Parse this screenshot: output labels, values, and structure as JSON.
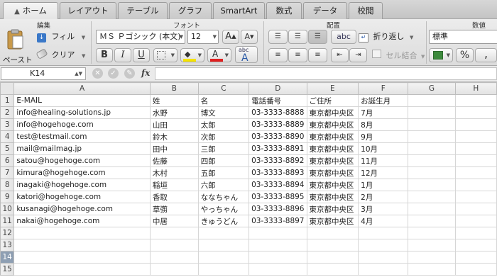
{
  "tabs": [
    {
      "label": "ホーム",
      "active": true
    },
    {
      "label": "レイアウト"
    },
    {
      "label": "テーブル"
    },
    {
      "label": "グラフ"
    },
    {
      "label": "SmartArt"
    },
    {
      "label": "数式"
    },
    {
      "label": "データ"
    },
    {
      "label": "校閲"
    }
  ],
  "ribbon": {
    "group_edit": "編集",
    "group_font": "フォント",
    "group_align": "配置",
    "group_number": "数値",
    "paste_label": "ペースト",
    "fill_label": "フィル",
    "clear_label": "クリア",
    "font_name": "ＭＳ Ｐゴシック (本文)",
    "font_size": "12",
    "bold": "B",
    "italic": "I",
    "underline": "U",
    "abc_label": "abc",
    "wrap_label": "折り返し",
    "merge_label": "セル結合",
    "number_format": "標準",
    "percent": "%",
    "comma": ","
  },
  "formula_bar": {
    "cell_ref": "K14",
    "fx": "fx",
    "formula": ""
  },
  "sheet": {
    "columns": [
      "",
      "A",
      "B",
      "C",
      "D",
      "E",
      "F",
      "G",
      "H"
    ],
    "selected_row": "14",
    "rows": [
      {
        "n": "1",
        "cells": [
          "E-MAIL",
          "姓",
          "名",
          "電話番号",
          "ご住所",
          "お誕生月",
          "",
          ""
        ]
      },
      {
        "n": "2",
        "cells": [
          "info@healing-solutions.jp",
          "水野",
          "博文",
          "03-3333-8888",
          "東京都中央区",
          "7月",
          "",
          ""
        ]
      },
      {
        "n": "3",
        "cells": [
          "info@hogehoge.com",
          "山田",
          "太郎",
          "03-3333-8889",
          "東京都中央区",
          "8月",
          "",
          ""
        ]
      },
      {
        "n": "4",
        "cells": [
          "test@testmail.com",
          "鈴木",
          "次郎",
          "03-3333-8890",
          "東京都中央区",
          "9月",
          "",
          ""
        ]
      },
      {
        "n": "5",
        "cells": [
          "mail@mailmag.jp",
          "田中",
          "三郎",
          "03-3333-8891",
          "東京都中央区",
          "10月",
          "",
          ""
        ]
      },
      {
        "n": "6",
        "cells": [
          "satou@hogehoge.com",
          "佐藤",
          "四郎",
          "03-3333-8892",
          "東京都中央区",
          "11月",
          "",
          ""
        ]
      },
      {
        "n": "7",
        "cells": [
          "kimura@hogehoge.com",
          "木村",
          "五郎",
          "03-3333-8893",
          "東京都中央区",
          "12月",
          "",
          ""
        ]
      },
      {
        "n": "8",
        "cells": [
          "inagaki@hogehoge.com",
          "稲垣",
          "六郎",
          "03-3333-8894",
          "東京都中央区",
          "1月",
          "",
          ""
        ]
      },
      {
        "n": "9",
        "cells": [
          "katori@hogehoge.com",
          "香取",
          "ななちゃん",
          "03-3333-8895",
          "東京都中央区",
          "2月",
          "",
          ""
        ]
      },
      {
        "n": "10",
        "cells": [
          "kusanagi@hogehoge.com",
          "草彅",
          "やっちゃん",
          "03-3333-8896",
          "東京都中央区",
          "3月",
          "",
          ""
        ]
      },
      {
        "n": "11",
        "cells": [
          "nakai@hogehoge.com",
          "中居",
          "きゅうどん",
          "03-3333-8897",
          "東京都中央区",
          "4月",
          "",
          ""
        ]
      },
      {
        "n": "12",
        "cells": [
          "",
          "",
          "",
          "",
          "",
          "",
          "",
          ""
        ]
      },
      {
        "n": "13",
        "cells": [
          "",
          "",
          "",
          "",
          "",
          "",
          "",
          ""
        ]
      },
      {
        "n": "14",
        "cells": [
          "",
          "",
          "",
          "",
          "",
          "",
          "",
          ""
        ]
      },
      {
        "n": "15",
        "cells": [
          "",
          "",
          "",
          "",
          "",
          "",
          "",
          ""
        ]
      }
    ]
  },
  "colors": {
    "font_color": "#e02020",
    "highlight": "#f5e300",
    "selected_row_header": "#8e9fb3"
  }
}
